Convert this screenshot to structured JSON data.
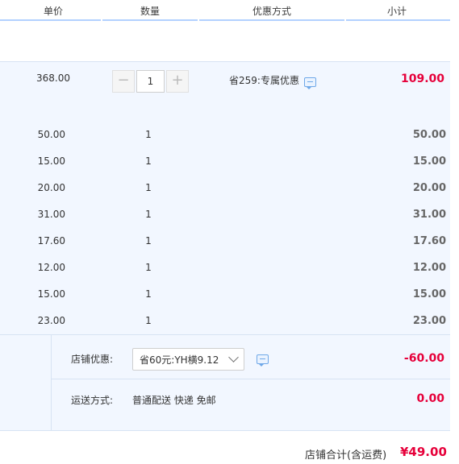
{
  "header": {
    "col_price": "单价",
    "col_qty": "数量",
    "col_discount": "优惠方式",
    "col_subtotal": "小计"
  },
  "main_item": {
    "price": "368.00",
    "qty": "1",
    "promo": "省259:专属优惠",
    "subtotal": "109.00",
    "minus": "−",
    "plus": "+"
  },
  "items": [
    {
      "price": "50.00",
      "qty": "1",
      "subtotal": "50.00"
    },
    {
      "price": "15.00",
      "qty": "1",
      "subtotal": "15.00"
    },
    {
      "price": "20.00",
      "qty": "1",
      "subtotal": "20.00"
    },
    {
      "price": "31.00",
      "qty": "1",
      "subtotal": "31.00"
    },
    {
      "price": "17.60",
      "qty": "1",
      "subtotal": "17.60"
    },
    {
      "price": "12.00",
      "qty": "1",
      "subtotal": "12.00"
    },
    {
      "price": "15.00",
      "qty": "1",
      "subtotal": "15.00"
    },
    {
      "price": "23.00",
      "qty": "1",
      "subtotal": "23.00"
    }
  ],
  "shop": {
    "discount_label": "店铺优惠:",
    "discount_value": "省60元:YH横9.12",
    "discount_amount": "-60.00",
    "shipping_label": "运送方式:",
    "shipping_value": "普通配送 快递 免邮",
    "shipping_amount": "0.00"
  },
  "total": {
    "label": "店铺合计(含运费)",
    "amount": "¥49.00"
  },
  "colors": {
    "accent_red": "#e6003a",
    "row_bg": "#f2f7ff",
    "header_line": "#b2d1ff"
  },
  "icons": {
    "chat": "chat-bubble-icon",
    "dropdown": "chevron-down-icon"
  }
}
